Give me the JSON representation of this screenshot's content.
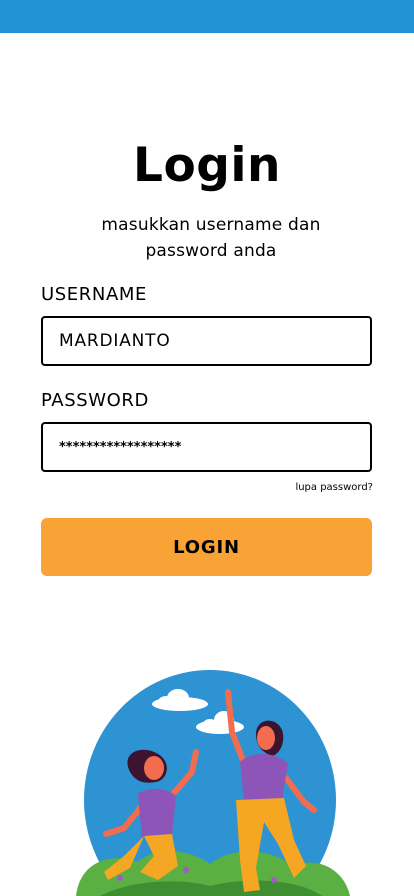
{
  "colors": {
    "status_bar": "#2392d4",
    "button": "#f9a235",
    "illustration_circle": "#2d93d3",
    "grass": "#5bb043"
  },
  "login": {
    "title": "Login",
    "subtitle": "masukkan username dan password anda",
    "username_label": "USERNAME",
    "username_value": "MARDIANTO",
    "password_label": "PASSWORD",
    "password_value": "******************",
    "forgot_password": "lupa password?",
    "login_button": "LOGIN"
  },
  "illustration": {
    "icon": "two-women-jumping-illustration"
  }
}
